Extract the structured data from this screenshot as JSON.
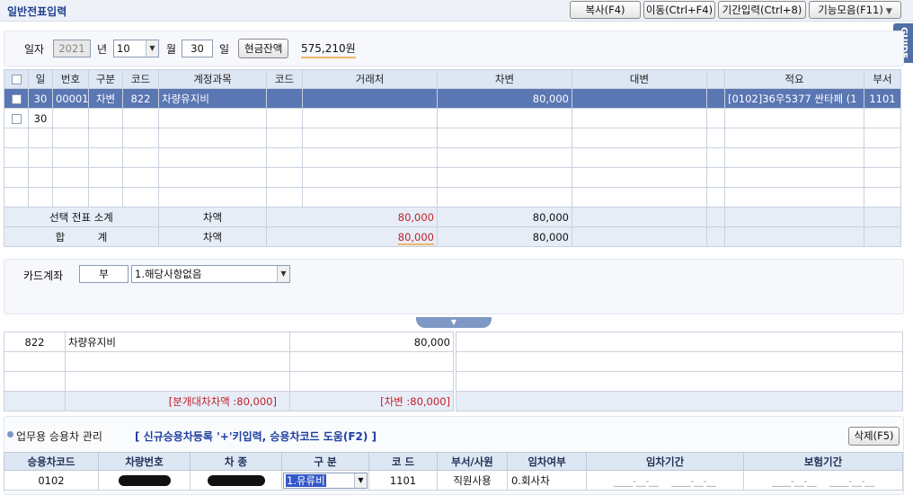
{
  "header": {
    "title": "일반전표입력",
    "buttons": [
      "복사(F4)",
      "이동(Ctrl+F4)",
      "기간입력(Ctrl+8)",
      "기능모음(F11)"
    ],
    "guide": "GUIDE"
  },
  "date_row": {
    "date_label": "일자",
    "year": "2021",
    "year_unit": "년",
    "month": "10",
    "month_unit": "월",
    "day": "30",
    "day_unit": "일",
    "cash_button": "현금잔액",
    "cash_value": "575,210원"
  },
  "grid": {
    "columns": [
      "",
      "일",
      "번호",
      "구분",
      "코드",
      "계정과목",
      "코드",
      "거래처",
      "차변",
      "대변",
      "",
      "적요",
      "부서"
    ],
    "rows": [
      {
        "day": "30",
        "no": "00001",
        "type": "차변",
        "code": "822",
        "account": "차량유지비",
        "vcode": "",
        "vendor": "",
        "debit": "80,000",
        "credit": "",
        "memo": "[0102]36우5377 싼타페 (1",
        "dept": "1101"
      },
      {
        "day": "30",
        "no": "",
        "type": "",
        "code": "",
        "account": "",
        "vcode": "",
        "vendor": "",
        "debit": "",
        "credit": "",
        "memo": "",
        "dept": ""
      }
    ],
    "subtotal": {
      "label": "선택 전표 소계",
      "diff_label": "차액",
      "diff": "80,000",
      "debit": "80,000"
    },
    "total": {
      "label": "합          계",
      "diff_label": "차액",
      "diff": "80,000",
      "debit": "80,000"
    }
  },
  "card": {
    "label": "카드계좌",
    "flag": "부",
    "option": "1.해당사항없음"
  },
  "journal": {
    "code": "822",
    "account": "차량유지비",
    "amount": "80,000",
    "balance_note": "[분개대차차액 :80,000]",
    "debit_note": "[차변 :80,000]"
  },
  "vehicle": {
    "title": "업무용 승용차 관리",
    "hint": "[ 신규승용차등록 '+'키입력, 승용차코드 도움(F2) ]",
    "delete_button": "삭제(F5)",
    "columns": [
      "승용차코드",
      "차량번호",
      "차  종",
      "구 분",
      "코 드",
      "부서/사원",
      "임차여부",
      "임차기간",
      "보험기간"
    ],
    "row": {
      "car_code": "0102",
      "category": "1.유류비",
      "code": "1101",
      "dept": "직원사용",
      "lease": "0.회사차",
      "date_placeholder": "____-__-__"
    }
  },
  "colors": {
    "accent": "#1e3f8f",
    "selection": "#5a76b3",
    "header_bg": "#dde6f3",
    "red": "#c0202a"
  }
}
